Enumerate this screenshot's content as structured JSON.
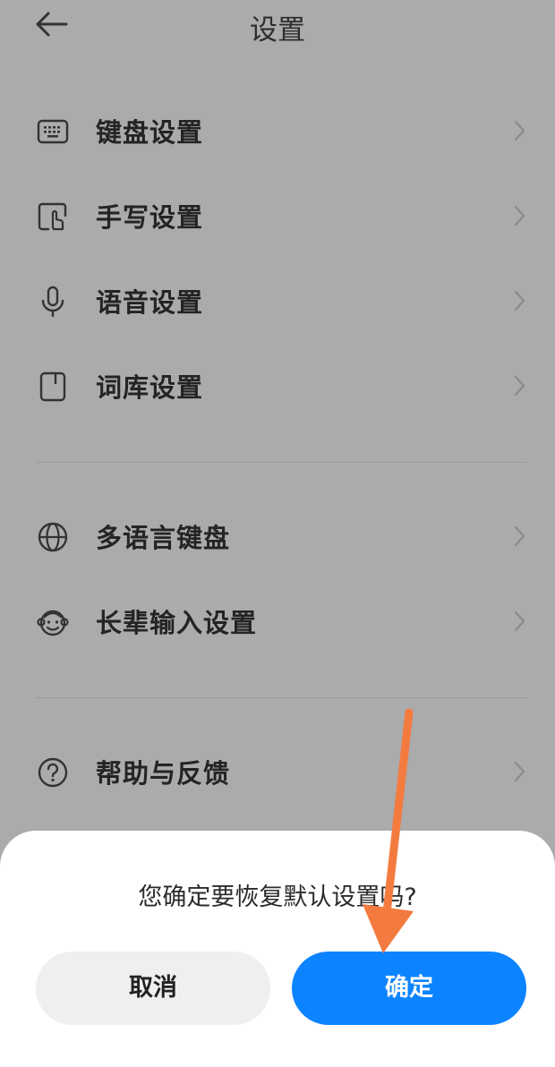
{
  "header": {
    "title": "设置"
  },
  "groups": [
    {
      "items": [
        {
          "label": "键盘设置",
          "icon": "keyboard-icon"
        },
        {
          "label": "手写设置",
          "icon": "handwriting-icon"
        },
        {
          "label": "语音设置",
          "icon": "microphone-icon"
        },
        {
          "label": "词库设置",
          "icon": "dictionary-icon"
        }
      ]
    },
    {
      "items": [
        {
          "label": "多语言键盘",
          "icon": "globe-icon"
        },
        {
          "label": "长辈输入设置",
          "icon": "elder-face-icon"
        }
      ]
    },
    {
      "items": [
        {
          "label": "帮助与反馈",
          "icon": "help-icon"
        }
      ]
    }
  ],
  "dialog": {
    "question": "您确定要恢复默认设置吗?",
    "cancel_label": "取消",
    "ok_label": "确定"
  },
  "colors": {
    "overlay_bg": "#ababab",
    "primary_button": "#0d84ff",
    "annotation_arrow": "#f47b3f"
  }
}
